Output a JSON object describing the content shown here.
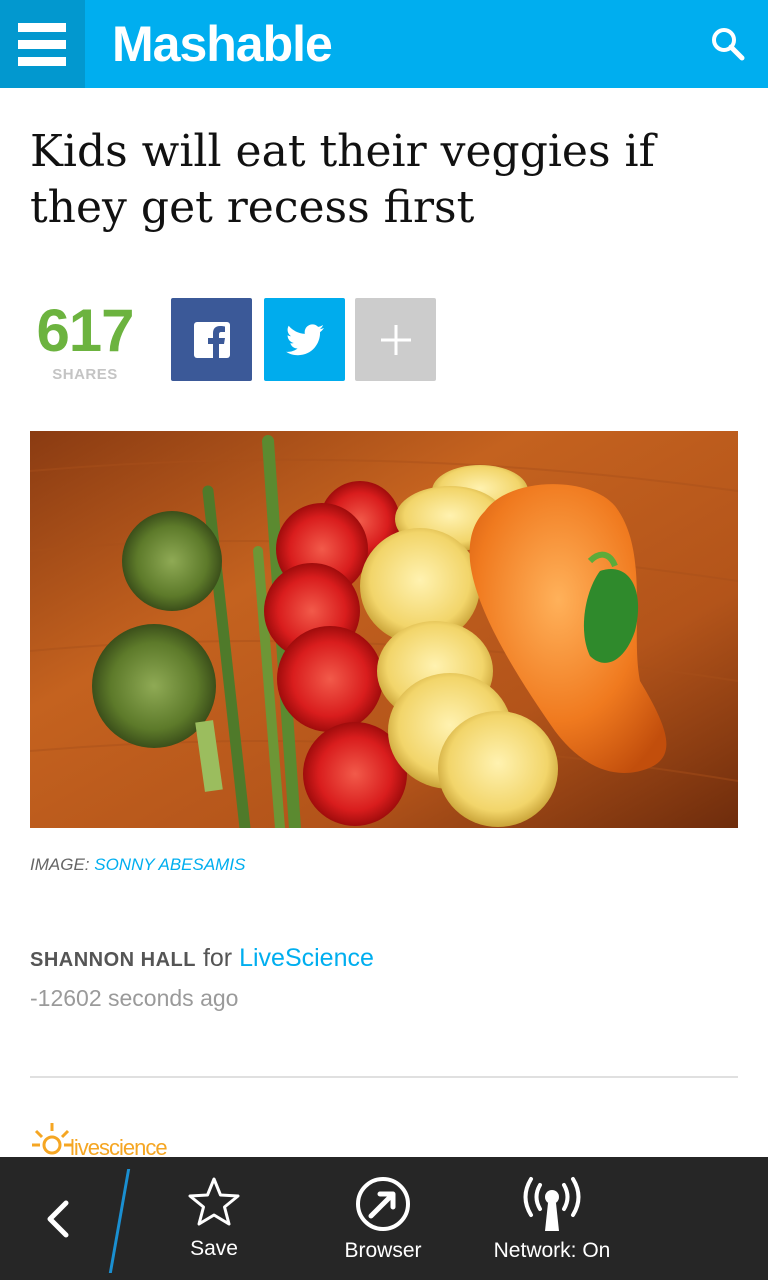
{
  "header": {
    "brand": "Mashable",
    "menu_icon": "hamburger-menu-icon",
    "search_icon": "search-icon",
    "background": "#00aeef",
    "menu_background": "#0298cf"
  },
  "article": {
    "headline": "Kids will eat their veggies if they get recess first",
    "shares": {
      "count": "617",
      "label": "SHARES",
      "count_color": "#6cb33f"
    },
    "share_buttons": [
      {
        "network": "facebook",
        "icon": "facebook-icon",
        "color": "#3b5998"
      },
      {
        "network": "twitter",
        "icon": "twitter-icon",
        "color": "#00aced"
      },
      {
        "network": "more",
        "icon": "plus-icon",
        "color": "#cccccc"
      }
    ],
    "image_credit": {
      "prefix": "IMAGE:",
      "name": "SONNY ABESAMIS"
    },
    "byline": {
      "author": "SHANNON HALL",
      "connector": "for",
      "source": "LiveScience"
    },
    "timestamp": "-12602 seconds ago",
    "partner_logo_text": "livescience"
  },
  "action_bar": {
    "back_icon": "back-chevron-icon",
    "actions": [
      {
        "label": "Save",
        "icon": "star-icon"
      },
      {
        "label": "Browser",
        "icon": "browser-compass-icon"
      },
      {
        "label": "Network: On",
        "icon": "antenna-icon"
      }
    ],
    "background": "#262626"
  }
}
